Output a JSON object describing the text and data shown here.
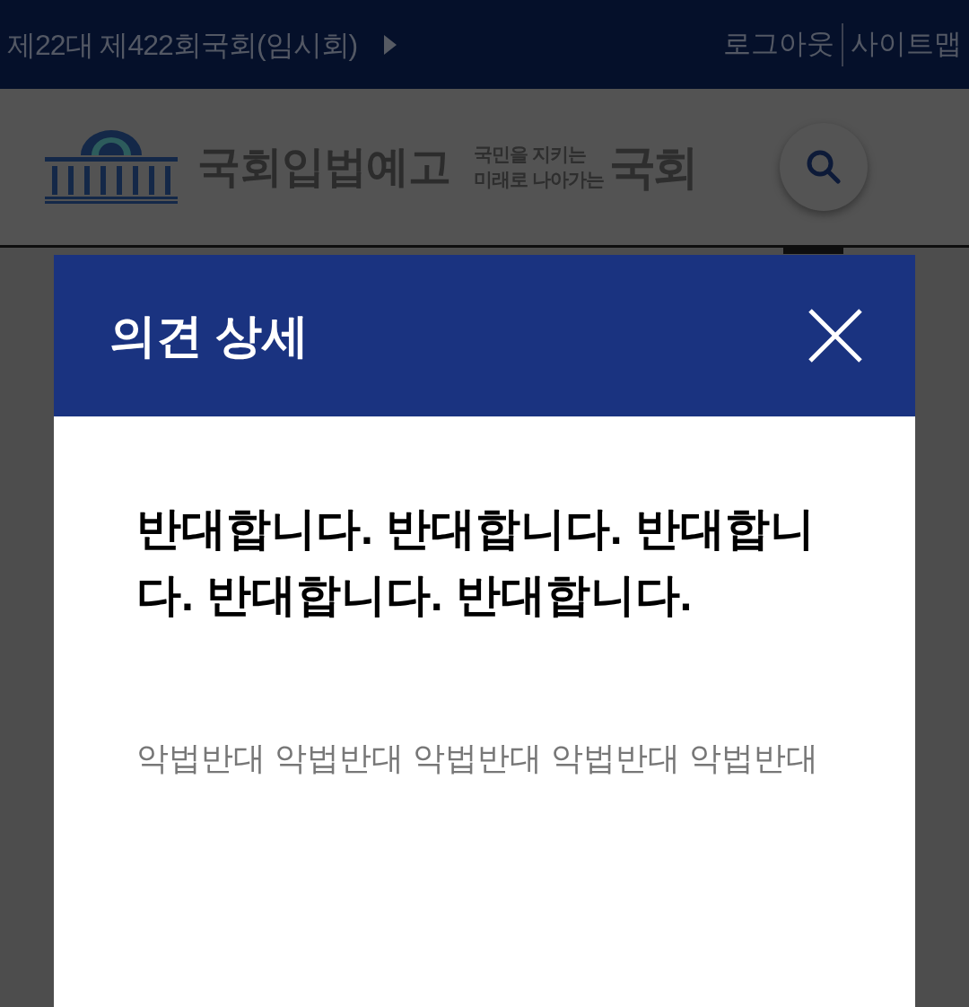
{
  "top_bar": {
    "session": "제22대 제422회국회(임시회)",
    "links": [
      "로그아웃",
      "사이트맵"
    ]
  },
  "header": {
    "logo_text": "국회입법예고",
    "slogan_lines": [
      "국민을 지키는",
      "미래로 나아가는"
    ],
    "slogan_mark": "국회"
  },
  "modal": {
    "title": "의견 상세",
    "opinion": "반대합니다. 반대합니다. 반대합니다. 반대합니다. 반대합니다.",
    "keywords": "악법반대 악법반대 악법반대 악법반대 악법반대"
  }
}
